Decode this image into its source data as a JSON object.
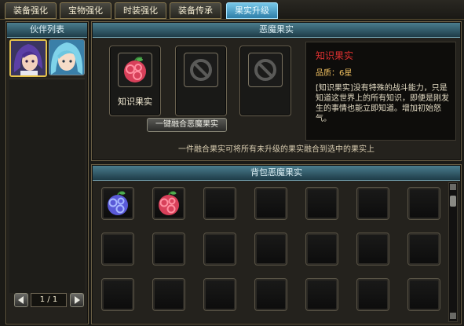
{
  "tabs": [
    {
      "label": "装备强化"
    },
    {
      "label": "宝物强化"
    },
    {
      "label": "时装强化"
    },
    {
      "label": "装备传承"
    },
    {
      "label": "果实升级",
      "active": true
    }
  ],
  "partner_list": {
    "title": "伙伴列表",
    "partners": [
      {
        "name": "purple-hair-partner"
      },
      {
        "name": "blue-hair-partner"
      }
    ],
    "page": "1 / 1"
  },
  "devil_fruit_panel": {
    "title": "恶魔果实",
    "selected_fruit_label": "知识果实",
    "merge_button": "一键融合恶魔果实",
    "hint": "一件融合果实可将所有未升级的果实融合到选中的果实上"
  },
  "fruit_info": {
    "name": "知识果实",
    "quality_label": "品质：",
    "quality_value": "6星",
    "description": "[知识果实]没有特殊的战斗能力，只是知道这世界上的所有知识，即便是刚发生的事情也能立即知道。增加初始怒气。"
  },
  "bag": {
    "title": "背包恶魔果实",
    "rows": 3,
    "cols": 7,
    "items": [
      "blue-swirl-fruit",
      "red-swirl-fruit"
    ]
  },
  "colors": {
    "accent_tab": "#3f95c0",
    "fruit_name": "#e03030",
    "quality": "#f0c060"
  }
}
